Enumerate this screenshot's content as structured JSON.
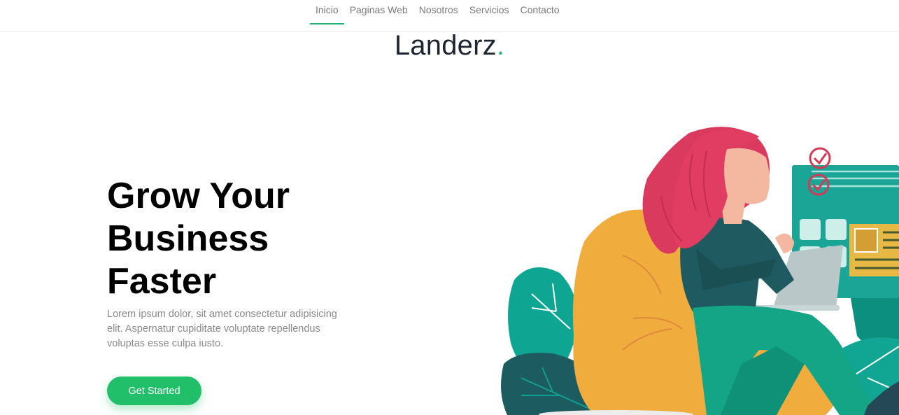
{
  "nav": {
    "items": [
      {
        "label": "Inicio",
        "active": true
      },
      {
        "label": "Paginas Web",
        "active": false
      },
      {
        "label": "Nosotros",
        "active": false
      },
      {
        "label": "Servicios",
        "active": false
      },
      {
        "label": "Contacto",
        "active": false
      }
    ]
  },
  "brand": {
    "name": "Landerz",
    "dot": "."
  },
  "hero": {
    "title_lines": [
      "Grow Your",
      "Business",
      "Faster"
    ],
    "text": "Lorem ipsum dolor, sit amet consectetur adipisicing elit. Aspernatur cupiditate voluptate repellendus voluptas esse culpa iusto.",
    "cta_label": "Get Started"
  },
  "colors": {
    "accent": "#21b573",
    "button": "#21bf6a",
    "title": "#000000",
    "body_text": "#8a8a8a"
  },
  "illustration": {
    "icon": "woman-with-laptop-illustration"
  }
}
